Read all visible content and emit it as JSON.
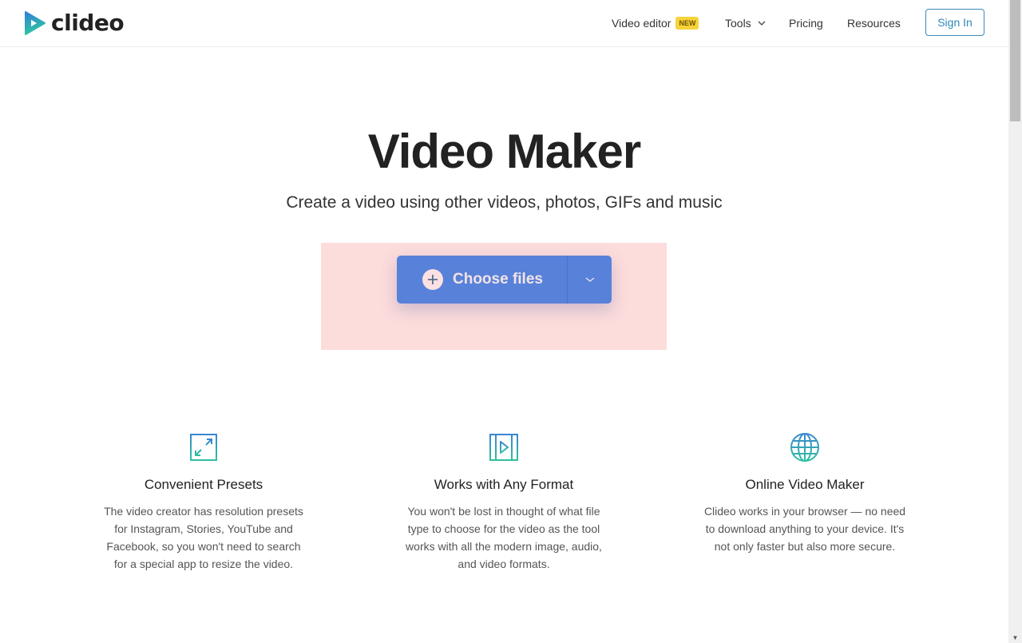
{
  "brand": {
    "name": "clideo",
    "colors": {
      "gradient_start": "#2f7fdc",
      "gradient_end": "#2fc6a0",
      "accent": "#5882d9",
      "drop_zone": "#fddcdc",
      "badge": "#f7d23a"
    }
  },
  "header": {
    "nav": [
      {
        "label": "Video editor",
        "badge": "NEW"
      },
      {
        "label": "Tools",
        "icon": "chevron-down-icon"
      },
      {
        "label": "Pricing"
      },
      {
        "label": "Resources"
      }
    ],
    "sign_in_label": "Sign In"
  },
  "hero": {
    "title": "Video Maker",
    "subtitle": "Create a video using other videos, photos, GIFs and music",
    "upload": {
      "button_label": "Choose files",
      "button_icon": "plus-circle-icon",
      "dropdown_icon": "chevron-down-icon"
    }
  },
  "features": [
    {
      "icon": "resize-arrows-icon",
      "title": "Convenient Presets",
      "text": "The video creator has resolution presets for Instagram, Stories, YouTube and Facebook, so you won't need to search for a special app to resize the video."
    },
    {
      "icon": "video-frame-icon",
      "title": "Works with Any Format",
      "text": "You won't be lost in thought of what file type to choose for the video as the tool works with all the modern image, audio, and video formats."
    },
    {
      "icon": "globe-icon",
      "title": "Online Video Maker",
      "text": "Clideo works in your browser — no need to download anything to your device. It's not only faster but also more secure."
    }
  ]
}
